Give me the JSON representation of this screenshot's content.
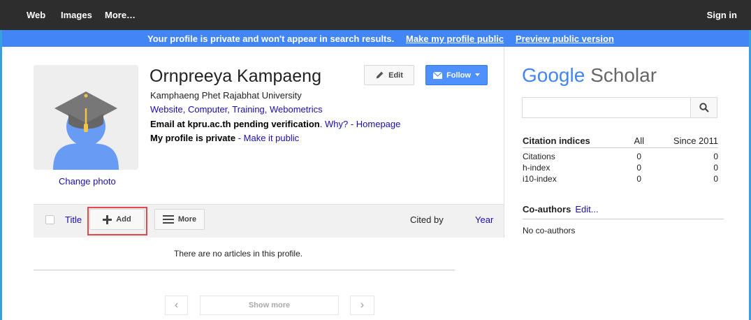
{
  "nav": {
    "web": "Web",
    "images": "Images",
    "more": "More…",
    "sign_in": "Sign in"
  },
  "banner": {
    "message": "Your profile is private and won't appear in search results.",
    "make_public": "Make my profile public",
    "preview": "Preview public version"
  },
  "profile": {
    "change_photo": "Change photo",
    "name": "Ornpreeya Kampaeng",
    "affiliation": "Kamphaeng Phet Rajabhat University",
    "interests": "Website, Computer, Training, Webometrics",
    "email_status": "Email at kpru.ac.th pending verification",
    "email_sep": ".",
    "why": "Why?",
    "homepage_sep": " - ",
    "homepage": "Homepage",
    "private_status": "My profile is private",
    "private_sep": " - ",
    "make_it_public": "Make it public",
    "edit_label": "Edit",
    "follow_label": "Follow"
  },
  "articles": {
    "title_col": "Title",
    "add_label": "Add",
    "more_label": "More",
    "cited_by_col": "Cited by",
    "year_col": "Year",
    "empty_msg": "There are no articles in this profile.",
    "show_more": "Show more",
    "prev_glyph": "‹",
    "next_glyph": "›"
  },
  "sidebar": {
    "logo_google": "Google",
    "logo_scholar": "Scholar",
    "search_placeholder": "",
    "citations": {
      "header": [
        "Citation indices",
        "All",
        "Since 2011"
      ],
      "rows": [
        [
          "Citations",
          "0",
          "0"
        ],
        [
          "h-index",
          "0",
          "0"
        ],
        [
          "i10-index",
          "0",
          "0"
        ]
      ]
    },
    "coauthors_label": "Co-authors",
    "coauthors_edit": "Edit...",
    "no_coauthors": "No co-authors"
  },
  "colors": {
    "accent": "#4285f4",
    "link": "#1a0dab",
    "follow_button": "#4d90fe",
    "highlight_box": "#e04a4a",
    "topbar": "#2d2d2d"
  },
  "icons": {
    "edit": "pencil-icon",
    "follow": "mail-icon",
    "add": "plus-icon",
    "more": "menu-icon",
    "search": "search-icon",
    "avatar": "graduation-cap-avatar"
  }
}
